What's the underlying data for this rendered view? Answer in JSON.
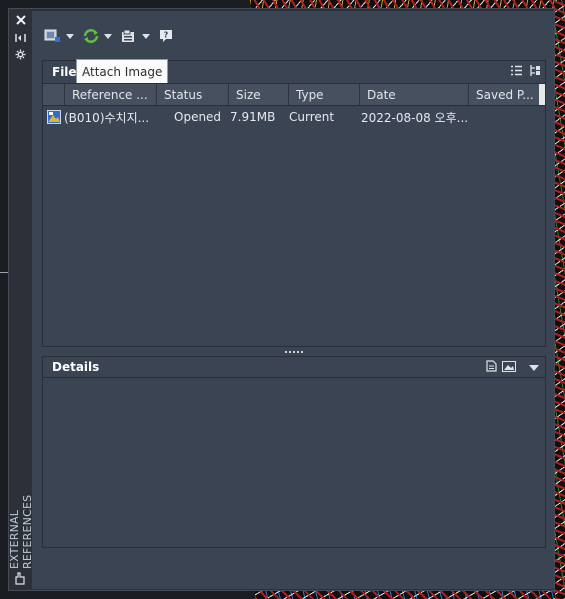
{
  "palette": {
    "title": "EXTERNAL REFERENCES",
    "close_icon": "×",
    "toolbar_tooltip": "Attach Image"
  },
  "file_references": {
    "section_title": "File",
    "columns": [
      "Reference ...",
      "Status",
      "Size",
      "Type",
      "Date",
      "Saved P..."
    ],
    "sort_column": "Reference ...",
    "sort_direction": "ascending",
    "rows": [
      {
        "name": "(B010)수치지...",
        "status": "Opened",
        "size": "7.91MB",
        "type": "Current",
        "date": "2022-08-08 오후...",
        "saved_path": "",
        "icon": "dwg-file-icon"
      }
    ]
  },
  "details": {
    "section_title": "Details"
  },
  "colors": {
    "panel_bg": "#3b4453",
    "header_bg": "#46505f",
    "frame_bg": "#2b3039",
    "tooltip_bg": "#fbfbfb"
  }
}
